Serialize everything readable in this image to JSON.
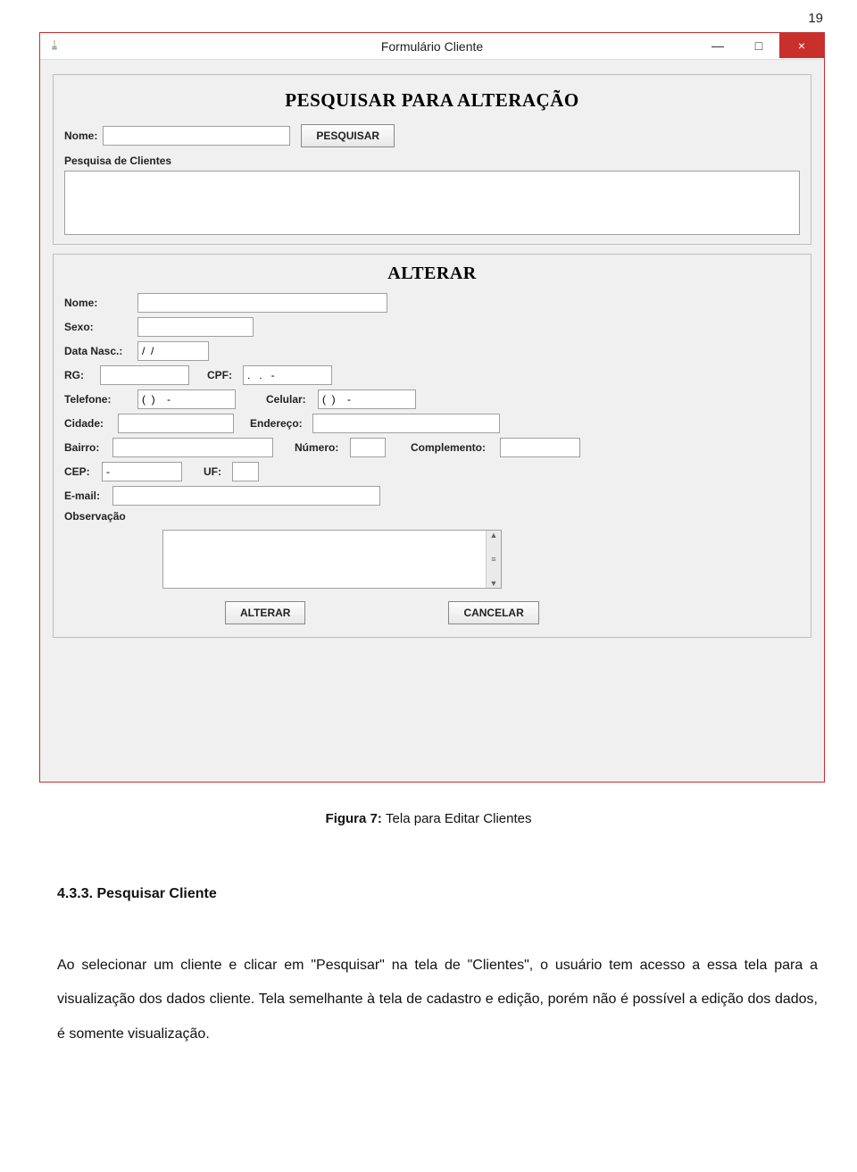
{
  "page_number": "19",
  "window": {
    "title": "Formulário Cliente",
    "controls": {
      "min": "—",
      "max": "□",
      "close": "×"
    }
  },
  "search": {
    "title": "PESQUISAR PARA ALTERAÇÃO",
    "name_label": "Nome:",
    "name_value": "",
    "button": "PESQUISAR",
    "results_label": "Pesquisa de Clientes"
  },
  "edit": {
    "title": "ALTERAR",
    "name_label": "Nome:",
    "name_value": "",
    "sexo_label": "Sexo:",
    "sexo_value": "",
    "datanasc_label": "Data Nasc.:",
    "datanasc_value": "/  /",
    "rg_label": "RG:",
    "rg_value": "",
    "cpf_label": "CPF:",
    "cpf_value": ".   .   -",
    "telefone_label": "Telefone:",
    "telefone_value": "(  )    -",
    "celular_label": "Celular:",
    "celular_value": "(  )    -",
    "cidade_label": "Cidade:",
    "cidade_value": "",
    "endereco_label": "Endereço:",
    "endereco_value": "",
    "bairro_label": "Bairro:",
    "bairro_value": "",
    "numero_label": "Número:",
    "numero_value": "",
    "complemento_label": "Complemento:",
    "complemento_value": "",
    "cep_label": "CEP:",
    "cep_value": "-",
    "uf_label": "UF:",
    "uf_value": "",
    "email_label": "E-mail:",
    "email_value": "",
    "obs_label": "Observação",
    "alterar_btn": "ALTERAR",
    "cancelar_btn": "CANCELAR"
  },
  "figure_caption_prefix": "Figura 7: ",
  "figure_caption_text": "Tela para Editar Clientes",
  "section_number": "4.3.3. Pesquisar Cliente",
  "body_text": "Ao selecionar um cliente e clicar em \"Pesquisar\" na tela de \"Clientes\", o usuário tem acesso a essa tela para a visualização dos dados cliente. Tela semelhante à tela de cadastro e edição, porém não é possível a edição dos dados, é somente visualização."
}
